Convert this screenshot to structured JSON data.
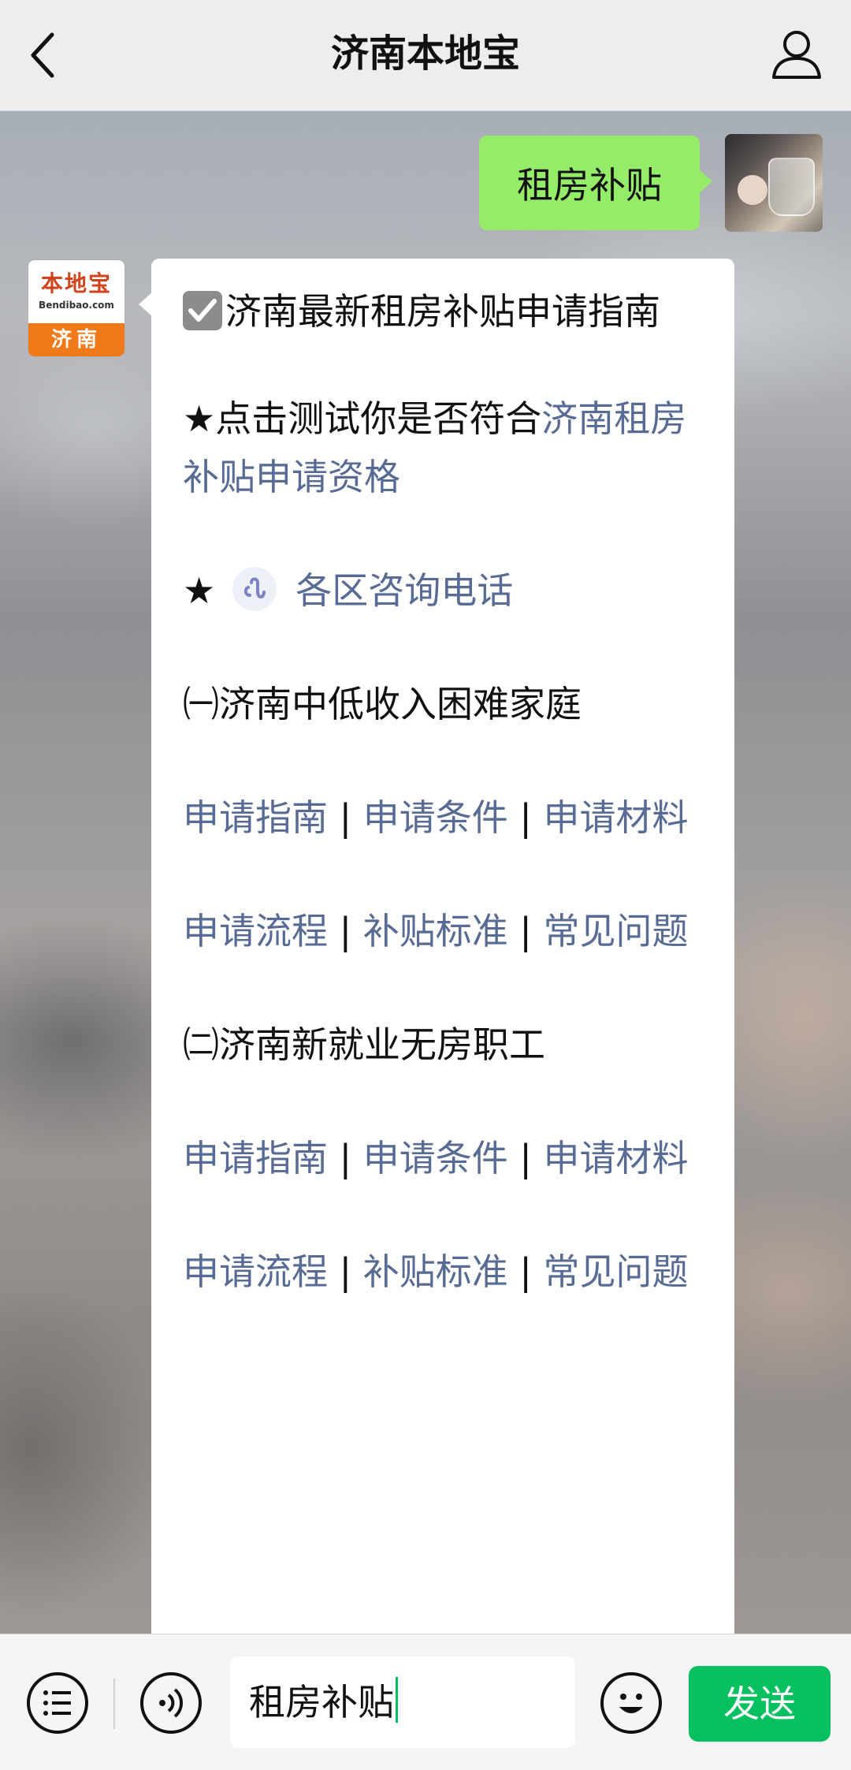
{
  "header": {
    "title": "济南本地宝",
    "back_icon": "chevron-left-icon",
    "profile_icon": "person-icon"
  },
  "sent_message": {
    "text": "租房补贴"
  },
  "bot_avatar": {
    "logo_text": "本地宝",
    "logo_sub": "Bendibao.com",
    "city": "济南"
  },
  "reply": {
    "title": "济南最新租房补贴申请指南",
    "test_prefix": "★点击测试你是否符合",
    "test_link": "济南租房补贴申请资格",
    "star": "★",
    "phone_link": "各区咨询电话",
    "section1_title": "㈠济南中低收入困难家庭",
    "section2_title": "㈡济南新就业无房职工",
    "links_row1": [
      "申请指南",
      "申请条件",
      "申请材料"
    ],
    "links_row2": [
      "申请流程",
      "补贴标准",
      "常见问题"
    ],
    "separator": "|"
  },
  "input_bar": {
    "text": "租房补贴",
    "send_label": "发送",
    "icons": [
      "menu-list-icon",
      "voice-icon",
      "emoji-icon"
    ]
  },
  "colors": {
    "link": "#576b95",
    "sent_bubble": "#95ec69",
    "send_button": "#07c160"
  }
}
